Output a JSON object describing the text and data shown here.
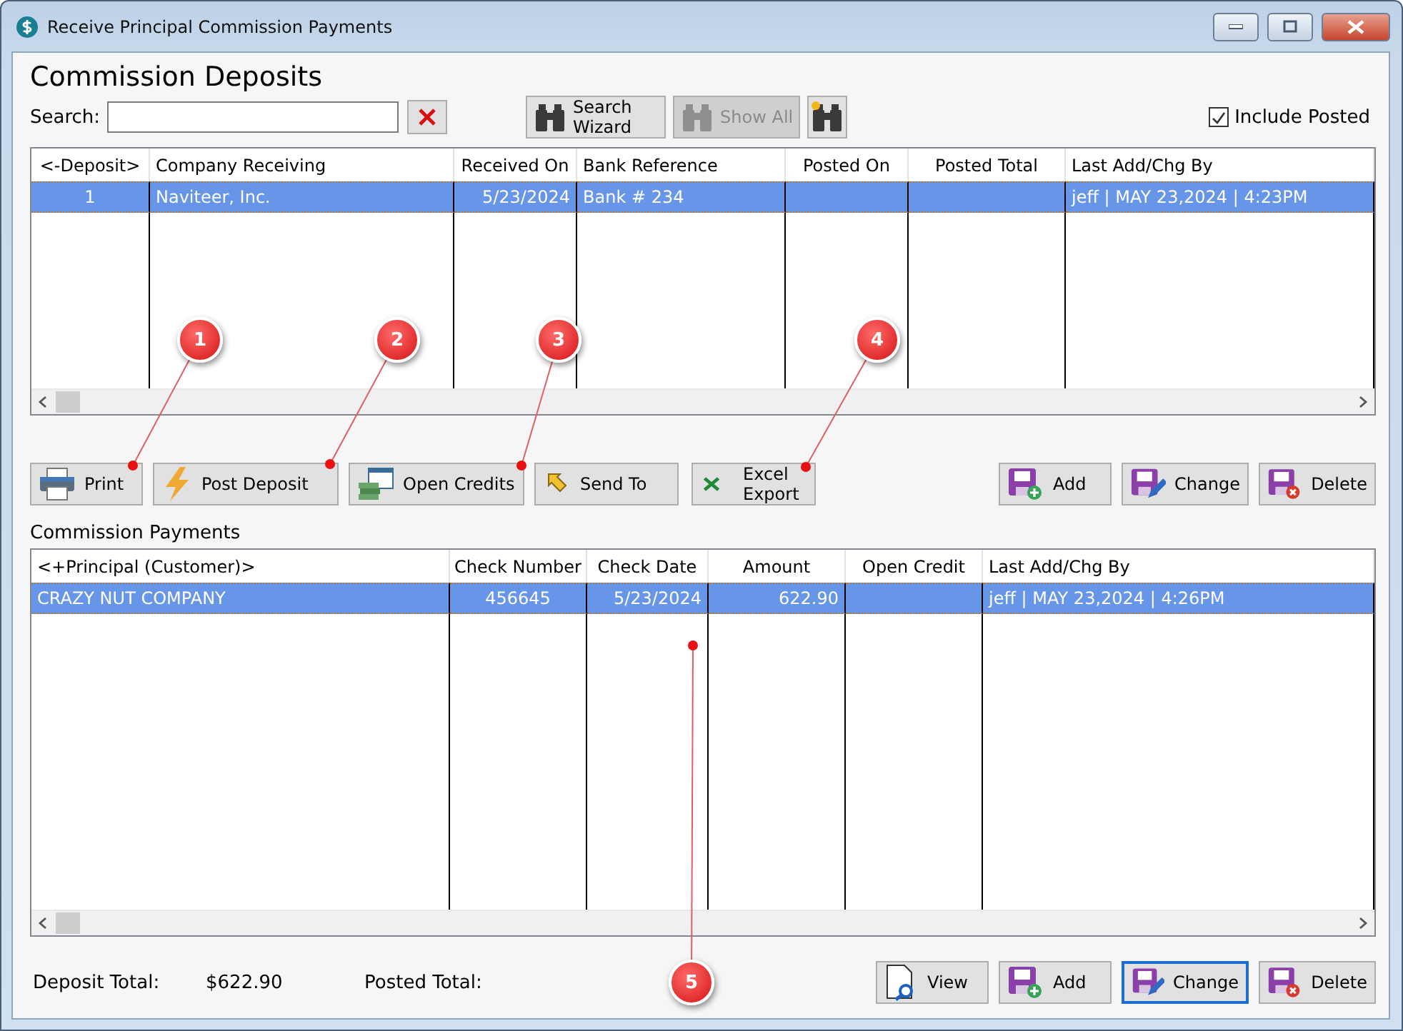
{
  "window": {
    "title": "Receive Principal Commission Payments"
  },
  "deposits": {
    "title": "Commission Deposits",
    "search": {
      "label": "Search:"
    },
    "tools": [
      {
        "kind": "clear",
        "disabled": false
      },
      {
        "kind": "search_wizard",
        "label": "Search Wizard",
        "disabled": false
      },
      {
        "kind": "show_all",
        "label": "Show All",
        "disabled": true
      },
      {
        "kind": "new_search",
        "disabled": false
      }
    ],
    "include_posted": {
      "label": "Include Posted",
      "checked": true
    },
    "table": {
      "columns": [
        "<-Deposit>",
        "Company Receiving",
        "Received On",
        "Bank Reference",
        "Posted On",
        "Posted Total",
        "Last Add/Chg By"
      ],
      "rows": [
        {
          "selected": true,
          "cells": [
            "1",
            "Naviteer, Inc.",
            "5/23/2024",
            "Bank # 234",
            null,
            null,
            "jeff | MAY 23,2024 |  4:23PM"
          ]
        }
      ]
    },
    "actions": [
      {
        "kind": "print",
        "label": "Print"
      },
      {
        "kind": "post",
        "label": "Post Deposit"
      },
      {
        "kind": "credits",
        "label": "Open Credits"
      },
      {
        "kind": "send",
        "label": "Send To"
      },
      {
        "kind": "excel",
        "label": "Excel Export"
      }
    ],
    "record_buttons": [
      {
        "kind": "add",
        "label": "Add",
        "focused": false
      },
      {
        "kind": "change",
        "label": "Change",
        "focused": false
      },
      {
        "kind": "delete",
        "label": "Delete",
        "focused": false
      }
    ]
  },
  "payments": {
    "title": "Commission Payments",
    "table": {
      "columns": [
        "<+Principal (Customer)>",
        "Check Number",
        "Check Date",
        "Amount",
        "Open Credit",
        "Last Add/Chg By"
      ],
      "rows": [
        {
          "selected": true,
          "cells": [
            "CRAZY NUT COMPANY",
            "456645",
            "5/23/2024",
            "622.90",
            null,
            "jeff | MAY 23,2024 |  4:26PM"
          ]
        }
      ]
    }
  },
  "footer": {
    "totals": [
      {
        "label": "Deposit Total:",
        "value": "$622.90"
      },
      {
        "label": "Posted Total:"
      }
    ],
    "buttons": [
      {
        "kind": "view",
        "label": "View",
        "focused": false
      },
      {
        "kind": "add",
        "label": "Add",
        "focused": false
      },
      {
        "kind": "change",
        "label": "Change",
        "focused": true
      },
      {
        "kind": "delete",
        "label": "Delete",
        "focused": false
      }
    ]
  },
  "callouts": [
    {
      "number": "1"
    },
    {
      "number": "2"
    },
    {
      "number": "3"
    },
    {
      "number": "4"
    },
    {
      "number": "5"
    }
  ]
}
